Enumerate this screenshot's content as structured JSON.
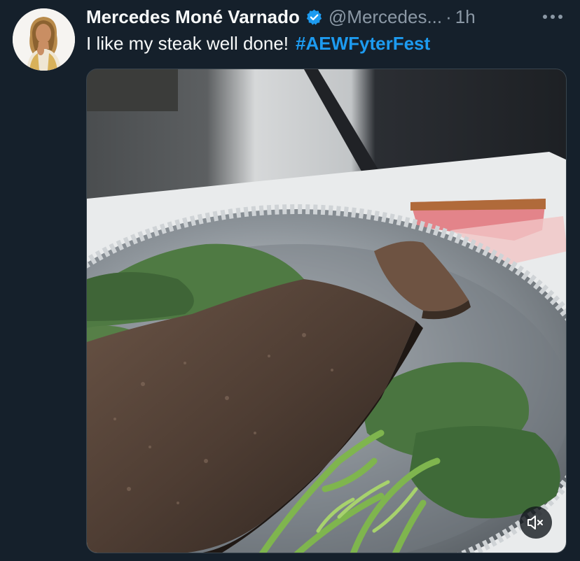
{
  "tweet": {
    "author_name": "Mercedes Moné Varnado",
    "author_handle": "@Mercedes...",
    "separator": "·",
    "time": "1h",
    "text": "I like my steak well done!",
    "hashtag": "#AEWFyterFest"
  },
  "icons": {
    "verified": "verified-badge-icon",
    "more": "more-options-icon",
    "mute": "volume-muted-icon"
  },
  "colors": {
    "background": "#15202b",
    "text_primary": "#f7f9f9",
    "text_secondary": "#8b98a5",
    "accent": "#1d9bf0"
  }
}
